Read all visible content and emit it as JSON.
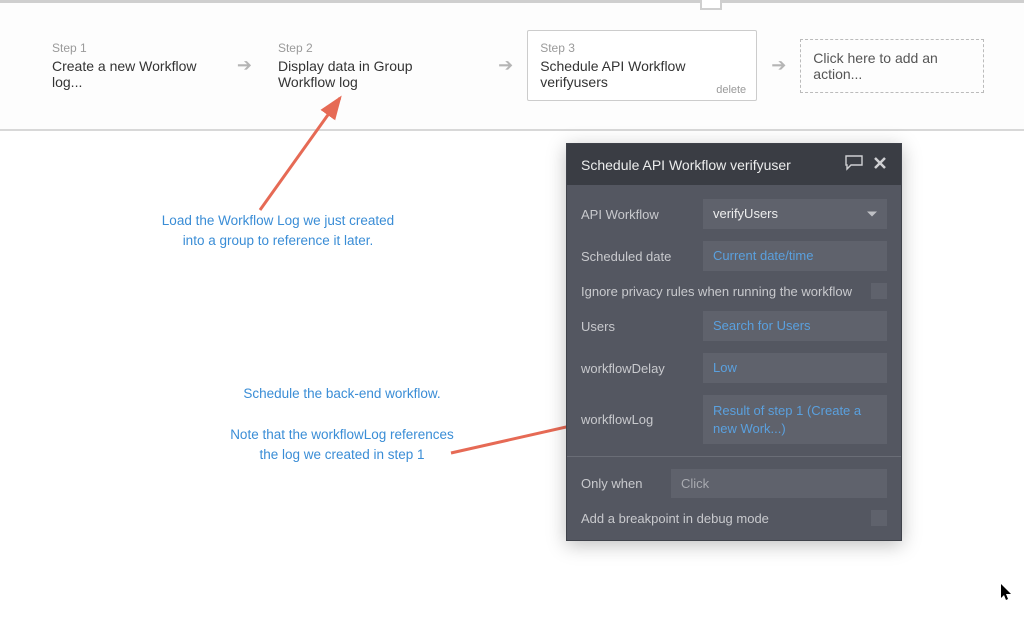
{
  "strip": {
    "step1": {
      "num": "Step 1",
      "title": "Create a new Workflow log..."
    },
    "step2": {
      "num": "Step 2",
      "title": "Display data in Group Workflow log"
    },
    "step3": {
      "num": "Step 3",
      "title": "Schedule API Workflow verifyusers",
      "delete": "delete"
    },
    "add": {
      "label": "Click here to add an action..."
    }
  },
  "callouts": {
    "c1": "Load the Workflow Log we just created into a group to reference it later.",
    "c2": "Schedule the back-end workflow.\n\nNote that the workflowLog references the log we created in step 1"
  },
  "panel": {
    "title": "Schedule API Workflow verifyuser",
    "rows": {
      "api": {
        "label": "API Workflow",
        "value": "verifyUsers"
      },
      "sched": {
        "label": "Scheduled date",
        "value": "Current date/time"
      },
      "ignore": {
        "label": "Ignore privacy rules when running the workflow"
      },
      "users": {
        "label": "Users",
        "value": "Search for Users"
      },
      "delay": {
        "label": "workflowDelay",
        "value": "Low"
      },
      "log": {
        "label": "workflowLog",
        "value": "Result of step 1 (Create a new Work...)"
      },
      "only": {
        "label": "Only when",
        "placeholder": "Click"
      },
      "debug": {
        "label": "Add a breakpoint in debug mode"
      }
    }
  }
}
